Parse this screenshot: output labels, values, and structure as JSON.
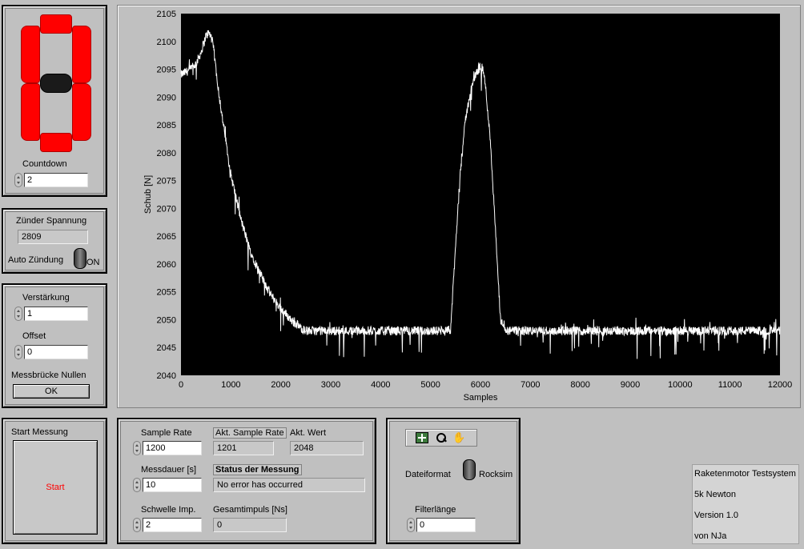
{
  "countdown": {
    "label": "Countdown",
    "value": "2",
    "digit": 0,
    "segment_color": "#ff0000"
  },
  "zuender": {
    "spannung_label": "Zünder Spannung",
    "spannung_value": "2809",
    "auto_label": "Auto Zündung",
    "toggle_state": "ON"
  },
  "messbruecke": {
    "verstaerkung_label": "Verstärkung",
    "verstaerkung_value": "1",
    "offset_label": "Offset",
    "offset_value": "0",
    "nullen_label": "Messbrücke Nullen",
    "ok_label": "OK"
  },
  "start": {
    "label": "Start Messung",
    "button_label": "Start",
    "button_text_color": "#ff0000"
  },
  "settings": {
    "sample_rate_label": "Sample Rate",
    "sample_rate_value": "1200",
    "akt_sample_rate_label": "Akt. Sample Rate",
    "akt_sample_rate_value": "1201",
    "akt_wert_label": "Akt. Wert",
    "akt_wert_value": "2048",
    "messdauer_label": "Messdauer [s]",
    "messdauer_value": "10",
    "status_label": "Status der Messung",
    "status_value": "No error has occurred",
    "schwelle_label": "Schwelle Imp.",
    "schwelle_value": "2",
    "gesamtimpuls_label": "Gesamtimpuls [Ns]",
    "gesamtimpuls_value": "0"
  },
  "file": {
    "dateiformat_label": "Dateiformat",
    "format_value": "Rocksim",
    "filterlaenge_label": "Filterlänge",
    "filterlaenge_value": "0",
    "palette_tools": [
      "crosshair-icon",
      "zoom-icon",
      "pan-hand-icon"
    ]
  },
  "info": {
    "lines": [
      "Raketenmotor Testsystem",
      "5k Newton",
      "Version 1.0",
      "von NJa"
    ]
  },
  "chart_data": {
    "type": "line",
    "xlabel": "Samples",
    "ylabel": "Schub [N]",
    "xlim": [
      0,
      12000
    ],
    "ylim": [
      2040,
      2105
    ],
    "xticks": [
      0,
      1000,
      2000,
      3000,
      4000,
      5000,
      6000,
      7000,
      8000,
      9000,
      10000,
      11000,
      12000
    ],
    "yticks": [
      2040,
      2045,
      2050,
      2055,
      2060,
      2065,
      2070,
      2075,
      2080,
      2085,
      2090,
      2095,
      2100,
      2105
    ],
    "background": "#000000",
    "line_color": "#ffffff",
    "series": [
      {
        "x": [
          0,
          100,
          200,
          300,
          400,
          500,
          550,
          600,
          650,
          700,
          800,
          900,
          1000,
          1200,
          1400,
          1600,
          1800,
          2000,
          2200,
          2400,
          2500,
          3000,
          4000,
          5000,
          5400,
          5500,
          5600,
          5700,
          5800,
          5900,
          6000,
          6050,
          6100,
          6200,
          6300,
          6400,
          6500,
          7000,
          8000,
          9000,
          10000,
          11000,
          12000
        ],
        "y": [
          2094,
          2094.5,
          2095,
          2096,
          2098,
          2101,
          2101.5,
          2101,
          2099,
          2095,
          2088,
          2082,
          2076,
          2068,
          2062,
          2058,
          2054.5,
          2052,
          2050,
          2048.5,
          2048,
          2048,
          2048,
          2048,
          2048,
          2063,
          2077,
          2086,
          2091,
          2094,
          2095.5,
          2095,
          2092,
          2082,
          2066,
          2050,
          2048,
          2048,
          2048,
          2048,
          2048,
          2048,
          2048
        ]
      }
    ]
  }
}
